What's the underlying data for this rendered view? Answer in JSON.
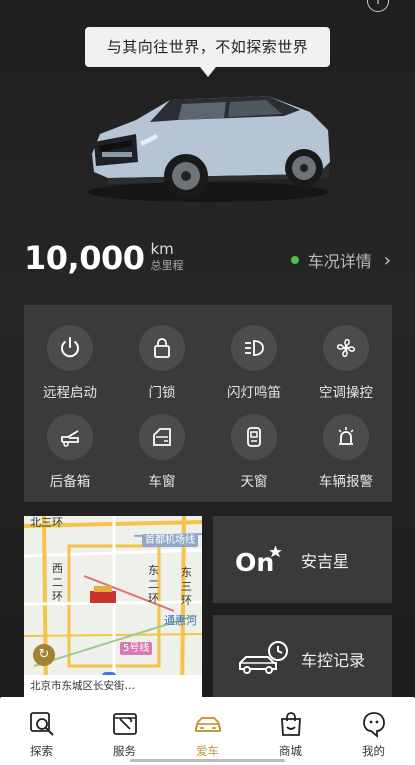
{
  "header": {
    "info_icon": "info-icon",
    "slogan": "与其向往世界，不如探索世界"
  },
  "vehicle": {
    "odometer_value": "10,000",
    "odometer_unit": "km",
    "odometer_label": "总里程",
    "status_label": "车况详情",
    "status_color": "#4ec04e"
  },
  "controls": [
    {
      "label": "远程启动",
      "icon": "power-icon"
    },
    {
      "label": "门锁",
      "icon": "lock-icon"
    },
    {
      "label": "闪灯鸣笛",
      "icon": "headlight-icon"
    },
    {
      "label": "空调操控",
      "icon": "fan-icon"
    },
    {
      "label": "后备箱",
      "icon": "trunk-icon"
    },
    {
      "label": "车窗",
      "icon": "window-icon"
    },
    {
      "label": "天窗",
      "icon": "sunroof-icon"
    },
    {
      "label": "车辆报警",
      "icon": "alarm-icon"
    }
  ],
  "map": {
    "labels": {
      "north_ring": "北三环",
      "airport": "首都机场线",
      "west_ring": "西\n二\n环",
      "east2": "东\n二\n环",
      "east3": "东\n三\n环",
      "tonghui": "通惠河",
      "line5": "5号线"
    },
    "address": "北京市东城区长安街…"
  },
  "cards": {
    "onstar_label": "安吉星",
    "onstar_logo": "On",
    "log_label": "车控记录"
  },
  "tabs": [
    {
      "label": "探索",
      "icon": "explore-icon",
      "active": false
    },
    {
      "label": "服务",
      "icon": "service-icon",
      "active": false
    },
    {
      "label": "爱车",
      "icon": "car-icon",
      "active": true
    },
    {
      "label": "商城",
      "icon": "shop-icon",
      "active": false
    },
    {
      "label": "我的",
      "icon": "profile-icon",
      "active": false
    }
  ],
  "colors": {
    "accent": "#c49a3c",
    "panel": "#3a3a3a",
    "icon_circle": "#4c4c4c"
  }
}
